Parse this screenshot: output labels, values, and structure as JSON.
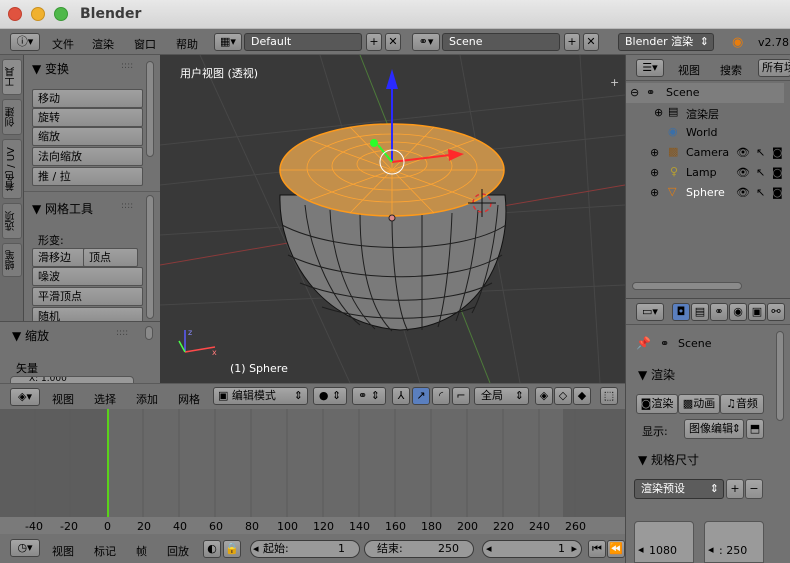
{
  "window": {
    "title": "Blender",
    "close_color": "#e0533f",
    "min_color": "#f0b12e",
    "max_color": "#4fb84a"
  },
  "topbar": {
    "menus": [
      "文件",
      "渲染",
      "窗口",
      "帮助"
    ],
    "layout": "Default",
    "scene": "Scene",
    "engine": "Blender 渲染",
    "version": "v2.78"
  },
  "tool_tabs": [
    "工具",
    "创建",
    "着色 / UV",
    "选项",
    "蜡笔"
  ],
  "tool_panel": {
    "transform_header": "变换",
    "transform_buttons": [
      "移动",
      "旋转",
      "缩放",
      "法向缩放",
      "推 / 拉"
    ],
    "mesh_tools_header": "网格工具",
    "deform_label": "形变:",
    "slide_edge": "滑移边",
    "vertex": "顶点",
    "noise": "噪波",
    "smooth_vertex": "平滑顶点",
    "random": "随机",
    "scale_header": "缩放",
    "vector_label": "矢量",
    "x_field": "X:    1.000"
  },
  "viewport": {
    "title": "用户视图 (透视)",
    "object_label": "(1) Sphere",
    "axis_x": "x",
    "axis_z": "z"
  },
  "view3d_header": {
    "menus": [
      "视图",
      "选择",
      "添加",
      "网格"
    ],
    "mode": "编辑模式",
    "orientation": "全局"
  },
  "timeline": {
    "ticks": [
      "-40",
      "-20",
      "0",
      "20",
      "40",
      "60",
      "80",
      "100",
      "120",
      "140",
      "160",
      "180",
      "200",
      "220",
      "240",
      "260"
    ],
    "current_frame": 1
  },
  "timeline_footer": {
    "menus": [
      "视图",
      "标记",
      "帧",
      "回放"
    ],
    "start_label": "起始:",
    "start_value": "1",
    "end_label": "结束:",
    "end_value": "250",
    "current_value": "1"
  },
  "outliner": {
    "view": "视图",
    "search": "搜索",
    "filter": "所有场",
    "items": [
      {
        "label": "Scene",
        "icon": "scene-icon"
      },
      {
        "label": "渲染层",
        "icon": "render-layer-icon"
      },
      {
        "label": "World",
        "icon": "world-icon"
      },
      {
        "label": "Camera",
        "icon": "camera-icon"
      },
      {
        "label": "Lamp",
        "icon": "lamp-icon"
      },
      {
        "label": "Sphere",
        "icon": "mesh-icon"
      }
    ]
  },
  "properties": {
    "scene_label": "Scene",
    "render_header": "渲染",
    "render_btn": "渲染",
    "animation_btn": "动画",
    "audio_btn": "音频",
    "display_label": "显示:",
    "display_value": "图像编辑",
    "dimensions_header": "规格尺寸",
    "preset_value": "渲染预设",
    "res_x": "1080",
    "res_y": ": 250"
  }
}
